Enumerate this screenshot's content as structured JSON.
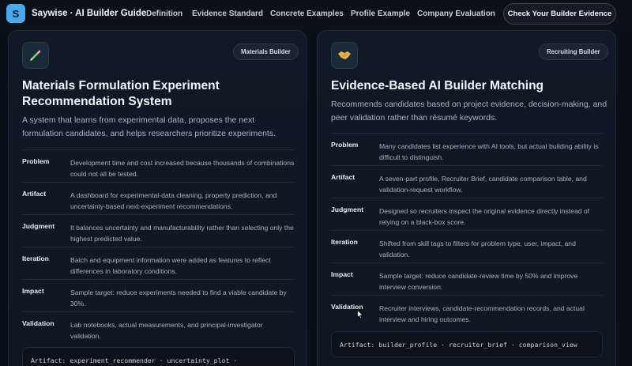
{
  "nav": {
    "logo_letter": "S",
    "brand": "Saywise · AI Builder Guide",
    "links": [
      "Definition",
      "Evidence Standard",
      "Concrete Examples",
      "Profile Example",
      "Company Evaluation"
    ],
    "cta": "Check Your Builder Evidence"
  },
  "cards": [
    {
      "icon": "pencil-icon",
      "badge": "Materials Builder",
      "title": "Materials Formulation Experiment Recommendation System",
      "description": "A system that learns from experimental data, proposes the next formulation candidates, and helps researchers prioritize experiments.",
      "rows": [
        {
          "label": "Problem",
          "text": "Development time and cost increased because thousands of combinations could not all be tested."
        },
        {
          "label": "Artifact",
          "text": "A dashboard for experimental-data cleaning, property prediction, and uncertainty-based next-experiment recommendations."
        },
        {
          "label": "Judgment",
          "text": "It balances uncertainty and manufacturability rather than selecting only the highest predicted value."
        },
        {
          "label": "Iteration",
          "text": "Batch and equipment information were added as features to reflect differences in laboratory conditions."
        },
        {
          "label": "Impact",
          "text": "Sample target: reduce experiments needed to find a viable candidate by 30%."
        },
        {
          "label": "Validation",
          "text": "Lab notebooks, actual measurements, and principal-investigator validation."
        }
      ],
      "code": "Artifact: experiment_recommender · uncertainty_plot ·"
    },
    {
      "icon": "handshake-icon",
      "badge": "Recruiting Builder",
      "title": "Evidence-Based AI Builder Matching",
      "description": "Recommends candidates based on project evidence, decision-making, and peer validation rather than résumé keywords.",
      "rows": [
        {
          "label": "Problem",
          "text": "Many candidates list experience with AI tools, but actual building ability is difficult to distinguish."
        },
        {
          "label": "Artifact",
          "text": "A seven-part profile, Recruiter Brief, candidate comparison table, and validation-request workflow."
        },
        {
          "label": "Judgment",
          "text": "Designed so recruiters inspect the original evidence directly instead of relying on a black-box score."
        },
        {
          "label": "Iteration",
          "text": "Shifted from skill tags to filters for problem type, user, impact, and validation."
        },
        {
          "label": "Impact",
          "text": "Sample target: reduce candidate-review time by 50% and improve interview conversion."
        },
        {
          "label": "Validation",
          "text": "Recruiter interviews, candidate-recommendation records, and actual interview and hiring outcomes."
        }
      ],
      "code": "Artifact: builder_profile · recruiter_brief · comparison_view"
    }
  ],
  "colors": {
    "accent": "#4aa8ee",
    "background": "#0a1018",
    "card": "#111926"
  }
}
